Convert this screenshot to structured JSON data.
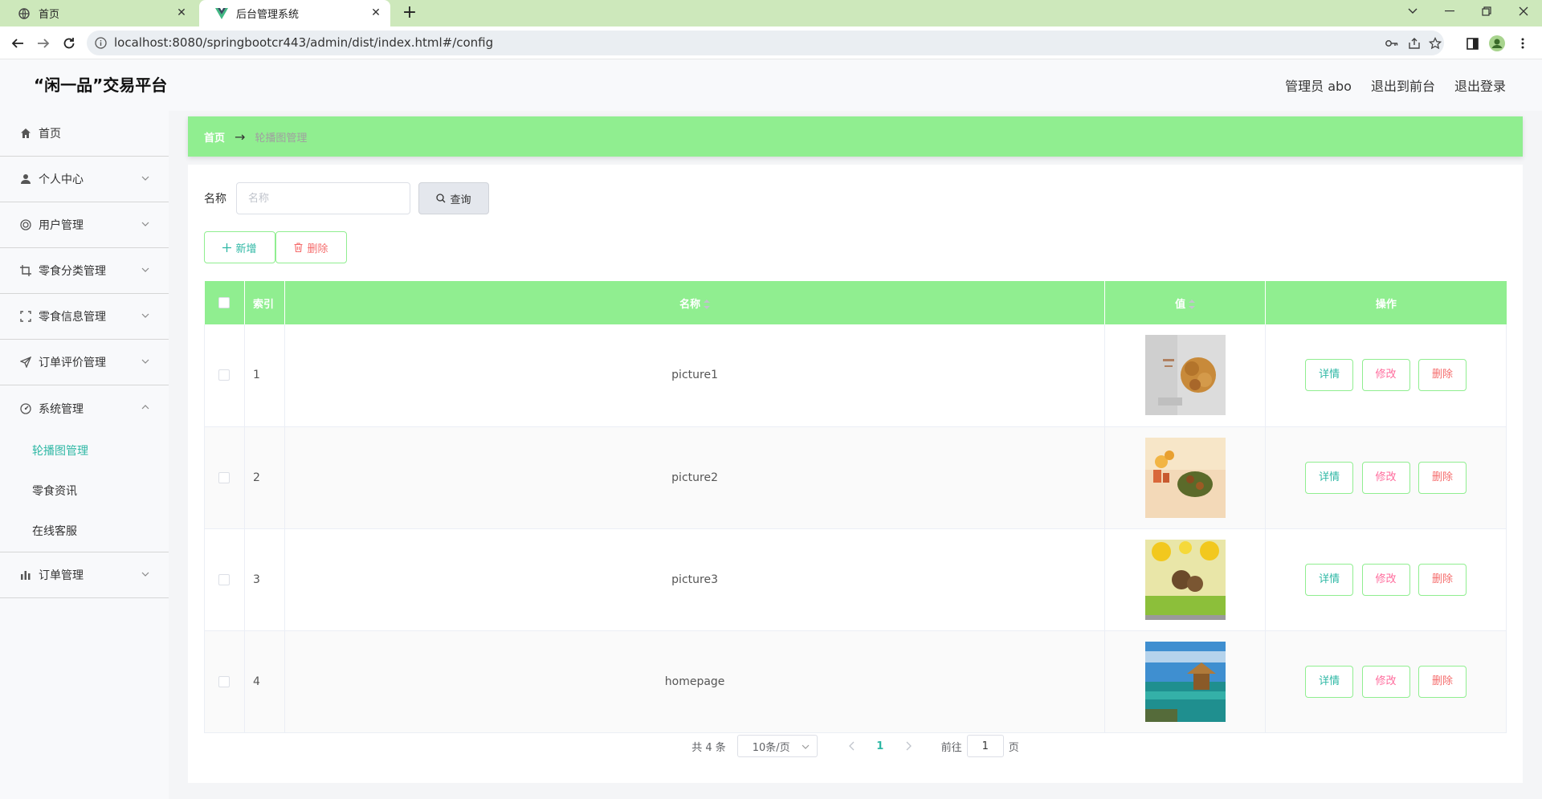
{
  "browser": {
    "tabs": [
      {
        "title": "首页"
      },
      {
        "title": "后台管理系统"
      }
    ],
    "url": "localhost:8080/springbootcr443/admin/dist/index.html#/config"
  },
  "header": {
    "title": "“闲一品”交易平台",
    "user": "管理员 abo",
    "to_front": "退出到前台",
    "logout": "退出登录"
  },
  "sidebar": {
    "items": [
      {
        "label": "首页",
        "icon": "home-icon"
      },
      {
        "label": "个人中心",
        "icon": "user-icon"
      },
      {
        "label": "用户管理",
        "icon": "circle-icon"
      },
      {
        "label": "零食分类管理",
        "icon": "crop-icon"
      },
      {
        "label": "零食信息管理",
        "icon": "fullscreen-icon"
      },
      {
        "label": "订单评价管理",
        "icon": "send-icon"
      },
      {
        "label": "系统管理",
        "icon": "dashboard-icon"
      },
      {
        "label": "订单管理",
        "icon": "bar-chart-icon"
      }
    ],
    "system_sub": [
      {
        "label": "轮播图管理",
        "active": true
      },
      {
        "label": "零食资讯",
        "active": false
      },
      {
        "label": "在线客服",
        "active": false
      }
    ]
  },
  "breadcrumb": {
    "home": "首页",
    "separator": "→",
    "current": "轮播图管理"
  },
  "search": {
    "label": "名称",
    "placeholder": "名称",
    "button": "查询"
  },
  "actions": {
    "add": "新增",
    "delete": "删除"
  },
  "table": {
    "columns": [
      "索引",
      "名称",
      "值",
      "操作"
    ],
    "rows": [
      {
        "index": "1",
        "name": "picture1",
        "thumb": "nuts-image"
      },
      {
        "index": "2",
        "name": "picture2",
        "thumb": "snack-bowl-image"
      },
      {
        "index": "3",
        "name": "picture3",
        "thumb": "fruit-snack-image"
      },
      {
        "index": "4",
        "name": "homepage",
        "thumb": "beach-hut-image"
      }
    ],
    "row_actions": {
      "detail": "详情",
      "edit": "修改",
      "delete": "删除"
    }
  },
  "pagination": {
    "total": "共 4 条",
    "page_size": "10条/页",
    "current_page": "1",
    "goto_label": "前往",
    "goto_value": "1",
    "page_unit": "页"
  },
  "colors": {
    "accent_green": "#90ee90",
    "teal_text": "#2fb8a5",
    "danger": "#f56c6c",
    "edit_pink": "#ff6b9c"
  }
}
